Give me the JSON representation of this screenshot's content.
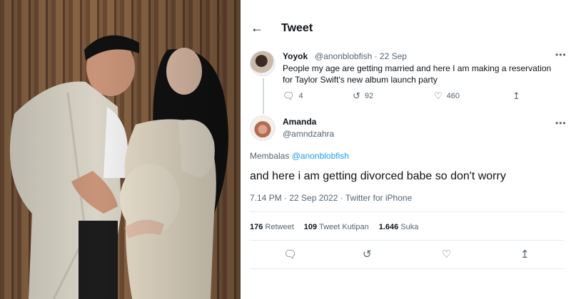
{
  "header": {
    "back_icon": "arrow-left-icon",
    "title": "Tweet"
  },
  "tweet1": {
    "name": "Yoyok",
    "handle_time": "@anonblobfish · 22 Sep",
    "text": "People my age are getting married and here I am making a reservation for Taylor Swift's new album launch party",
    "replies": "4",
    "retweets": "92",
    "likes": "460"
  },
  "tweet2": {
    "name": "Amanda",
    "handle": "@amndzahra",
    "replying_prefix": "Membalas ",
    "replying_to": "@anonblobfish",
    "text": "and here i am getting divorced babe so don't worry",
    "timestamp": "7.14 PM · 22 Sep 2022 · Twitter for iPhone",
    "stats": {
      "retweets_count": "176",
      "retweets_label": "Retweet",
      "quotes_count": "109",
      "quotes_label": "Tweet Kutipan",
      "likes_count": "1.646",
      "likes_label": "Suka"
    }
  },
  "icons": {
    "more": "more-horizontal-icon",
    "reply": "reply-icon",
    "retweet": "retweet-icon",
    "like": "heart-icon",
    "share": "share-icon"
  }
}
